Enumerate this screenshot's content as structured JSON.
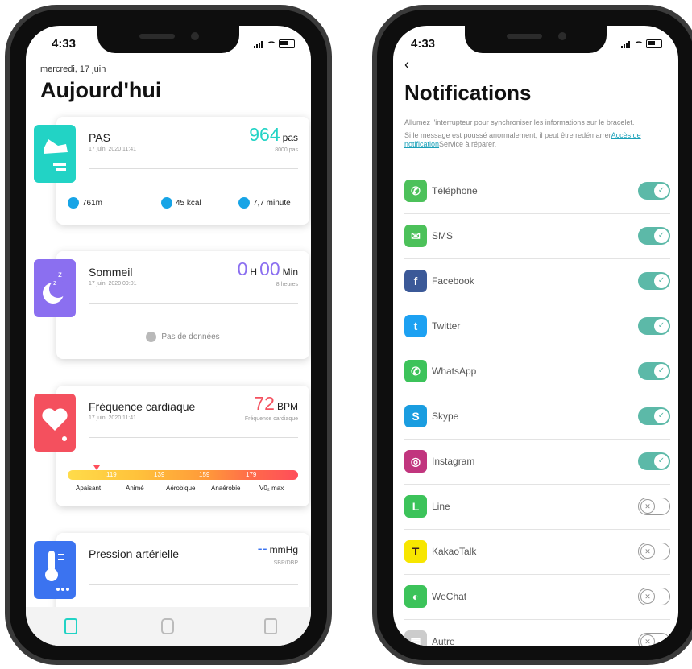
{
  "left": {
    "status_time": "4:33",
    "date": "mercredi, 17 juin",
    "title": "Aujourd'hui",
    "steps": {
      "title": "PAS",
      "subtitle": "17 juin, 2020 11:41",
      "value": "964",
      "unit": "pas",
      "goal": "8000 pas",
      "distance": "761m",
      "calories": "45 kcal",
      "duration": "7,7 minute",
      "color": "#22d3c5"
    },
    "sleep": {
      "title": "Sommeil",
      "subtitle": "17 juin, 2020 09:01",
      "value_h": "0",
      "unit_h": "H",
      "value_min": "00",
      "unit_min": "Min",
      "goal": "8 heures",
      "nodata": "Pas de données",
      "color": "#8b6ff0"
    },
    "heart": {
      "title": "Fréquence cardiaque",
      "subtitle": "17 juin, 2020 11:41",
      "value": "72",
      "unit": "BPM",
      "caption": "Fréquence cardiaque",
      "ticks": [
        "119",
        "139",
        "159",
        "179"
      ],
      "zones": [
        "Apaisant",
        "Animé",
        "Aérobique",
        "Anaérobie",
        "V0₂ max"
      ],
      "color": "#f4505e"
    },
    "pressure": {
      "title": "Pression artérielle",
      "value": "--",
      "unit": "mmHg",
      "caption": "SBP/DBP",
      "color": "#3b73f0"
    },
    "tabs": [
      "home-icon",
      "watch-icon",
      "profile-icon"
    ]
  },
  "right": {
    "status_time": "4:33",
    "back": "‹",
    "title": "Notifications",
    "desc1": "Allumez l'interrupteur pour synchroniser les informations sur le bracelet.",
    "desc2_a": "Si le message est poussé anormalement, il peut être redémarrer",
    "desc2_link": "Accès de notification",
    "desc2_b": "Service à réparer.",
    "items": [
      {
        "label": "Téléphone",
        "on": true,
        "icon": "phone-icon",
        "color": "#4cc15a"
      },
      {
        "label": "SMS",
        "on": true,
        "icon": "sms-icon",
        "color": "#4cc15a"
      },
      {
        "label": "Facebook",
        "on": true,
        "icon": "facebook-icon",
        "color": "#3b5998"
      },
      {
        "label": "Twitter",
        "on": true,
        "icon": "twitter-icon",
        "color": "#1da1f2"
      },
      {
        "label": "WhatsApp",
        "on": true,
        "icon": "whatsapp-icon",
        "color": "#3cc35a"
      },
      {
        "label": "Skype",
        "on": true,
        "icon": "skype-icon",
        "color": "#1a9de0"
      },
      {
        "label": "Instagram",
        "on": true,
        "icon": "instagram-icon",
        "color": "#c1357e"
      },
      {
        "label": "Line",
        "on": false,
        "icon": "line-icon",
        "color": "#3cc35a"
      },
      {
        "label": "KakaoTalk",
        "on": false,
        "icon": "kakaotalk-icon",
        "color": "#f7e600"
      },
      {
        "label": "WeChat",
        "on": false,
        "icon": "wechat-icon",
        "color": "#3cc35a"
      },
      {
        "label": "Autre",
        "on": false,
        "icon": "other-apps-icon",
        "color": "#cccccc"
      }
    ]
  }
}
